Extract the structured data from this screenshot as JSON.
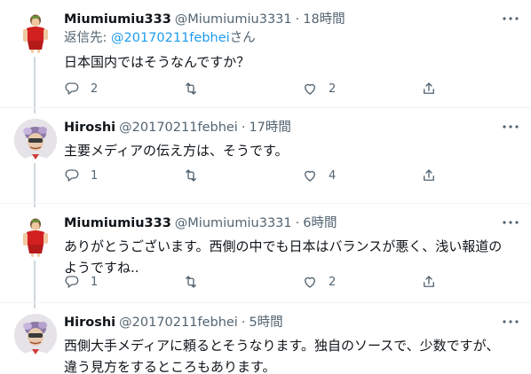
{
  "tweets": [
    {
      "name": "Miumiumiu333",
      "handle": "@Miumiumiu3331",
      "time": "18時間",
      "reply_prefix": "返信先: ",
      "reply_to": "@20170211febhei",
      "reply_suffix": "さん",
      "text": "日本国内ではそうなんですか？",
      "replies": "2",
      "retweets": "",
      "likes": "2"
    },
    {
      "name": "Hiroshi",
      "handle": "@20170211febhei",
      "time": "17時間",
      "text": "主要メディアの伝え方は、そうです。",
      "replies": "1",
      "retweets": "",
      "likes": "4"
    },
    {
      "name": "Miumiumiu333",
      "handle": "@Miumiumiu3331",
      "time": "6時間",
      "text_line1": "ありがとうございます。西側の中でも日本はバランスが悪く、浅い報道の",
      "text_line2": "ようですね..",
      "replies": "1",
      "retweets": "",
      "likes": "2"
    },
    {
      "name": "Hiroshi",
      "handle": "@20170211febhei",
      "time": "5時間",
      "text_line1": "西側大手メディアに頼るとそうなります。独自のソースで、少数ですが、",
      "text_line2": "違う見方をするところもあります。"
    }
  ],
  "separator": "·",
  "icons": {
    "reply": "reply-icon",
    "retweet": "retweet-icon",
    "like": "heart-icon",
    "share": "share-icon",
    "more": "more-icon"
  },
  "colors": {
    "link": "#1d9bf0",
    "secondary": "#536471",
    "thread_line": "#cfd9de"
  }
}
